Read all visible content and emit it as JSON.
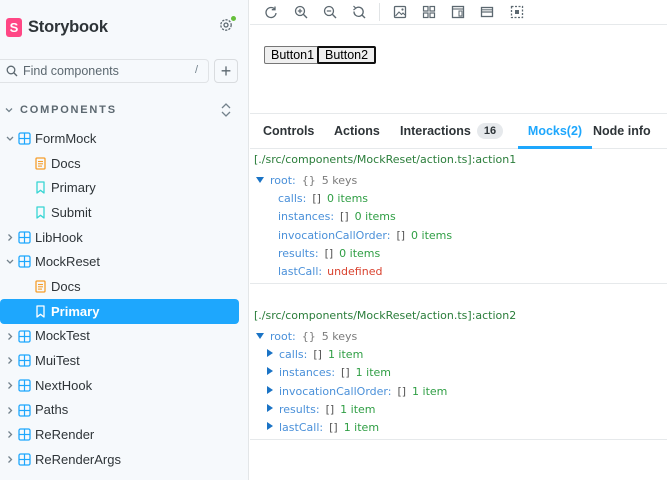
{
  "brand": {
    "name": "Storybook",
    "logo_letter": "S"
  },
  "search": {
    "placeholder": "Find components",
    "shortcut": "/"
  },
  "add_label": "+",
  "section": {
    "label": "COMPONENTS"
  },
  "tree": [
    {
      "label": "FormMock",
      "type": "component",
      "expanded": true
    },
    {
      "label": "Docs",
      "type": "docs"
    },
    {
      "label": "Primary",
      "type": "story"
    },
    {
      "label": "Submit",
      "type": "story"
    },
    {
      "label": "LibHook",
      "type": "component",
      "expanded": false
    },
    {
      "label": "MockReset",
      "type": "component",
      "expanded": true
    },
    {
      "label": "Docs",
      "type": "docs"
    },
    {
      "label": "Primary",
      "type": "story",
      "selected": true
    },
    {
      "label": "MockTest",
      "type": "component",
      "expanded": false
    },
    {
      "label": "MuiTest",
      "type": "component",
      "expanded": false
    },
    {
      "label": "NextHook",
      "type": "component",
      "expanded": false
    },
    {
      "label": "Paths",
      "type": "component",
      "expanded": false
    },
    {
      "label": "ReRender",
      "type": "component",
      "expanded": false
    },
    {
      "label": "ReRenderArgs",
      "type": "component",
      "expanded": false
    }
  ],
  "toolbar_icons": [
    "reload-icon",
    "zoom-in-icon",
    "zoom-out-icon",
    "zoom-reset-icon",
    "background-icon",
    "grid-icon",
    "viewport-icon",
    "measure-icon",
    "outline-icon"
  ],
  "preview": {
    "button1": "Button1",
    "button2": "Button2"
  },
  "tabs": [
    {
      "label": "Controls"
    },
    {
      "label": "Actions"
    },
    {
      "label": "Interactions",
      "badge": "16"
    },
    {
      "label": "Mocks(2)",
      "active": true
    },
    {
      "label": "Node info"
    }
  ],
  "mocks": [
    {
      "title": "[./src/components/MockReset/action.ts]:action1",
      "root_key": "root:",
      "root_meta": "{}",
      "root_count": "5 keys",
      "entries": [
        {
          "key": "calls:",
          "bracket": "[]",
          "value": "0 items",
          "value_type": "green"
        },
        {
          "key": "instances:",
          "bracket": "[]",
          "value": "0 items",
          "value_type": "green"
        },
        {
          "key": "invocationCallOrder:",
          "bracket": "[]",
          "value": "0 items",
          "value_type": "green"
        },
        {
          "key": "results:",
          "bracket": "[]",
          "value": "0 items",
          "value_type": "green"
        },
        {
          "key": "lastCall:",
          "bracket": "",
          "value": "undefined",
          "value_type": "red"
        }
      ]
    },
    {
      "title": "[./src/components/MockReset/action.ts]:action2",
      "root_key": "root:",
      "root_meta": "{}",
      "root_count": "5 keys",
      "entries": [
        {
          "key": "calls:",
          "bracket": "[]",
          "value": "1 item",
          "value_type": "green",
          "expandable": true
        },
        {
          "key": "instances:",
          "bracket": "[]",
          "value": "1 item",
          "value_type": "green",
          "expandable": true
        },
        {
          "key": "invocationCallOrder:",
          "bracket": "[]",
          "value": "1 item",
          "value_type": "green",
          "expandable": true
        },
        {
          "key": "results:",
          "bracket": "[]",
          "value": "1 item",
          "value_type": "green",
          "expandable": true
        },
        {
          "key": "lastCall:",
          "bracket": "[]",
          "value": "1 item",
          "value_type": "green",
          "expandable": true
        }
      ]
    }
  ],
  "colors": {
    "accent": "#1ea7fd",
    "brand": "#ff4785",
    "status_dot": "#66bf3c",
    "path_green": "#2a7d3a",
    "value_green": "#2f9e44",
    "key_blue": "#4a90d9",
    "undefined_red": "#d9422f"
  }
}
